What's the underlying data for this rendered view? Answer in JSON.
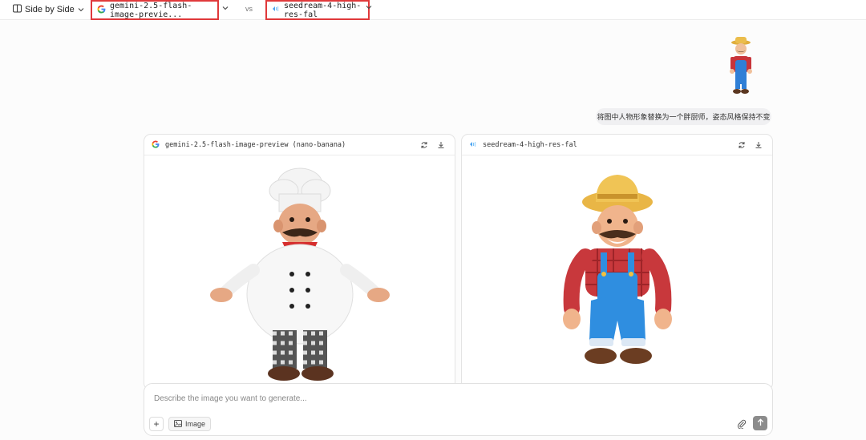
{
  "header": {
    "mode_label": "Side by Side",
    "model_a": "gemini-2.5-flash-image-previe...",
    "vs_label": "vs",
    "model_b": "seedream-4-high-res-fal"
  },
  "conversation": {
    "user_prompt": "将图中人物形象替换为一个胖厨师，姿态风格保持不变"
  },
  "panels": [
    {
      "title": "gemini-2.5-flash-image-preview (nano-banana)",
      "icon": "google-icon"
    },
    {
      "title": "seedream-4-high-res-fal",
      "icon": "seedream-icon"
    }
  ],
  "composer": {
    "placeholder": "Describe the image you want to generate...",
    "image_label": "Image"
  },
  "colors": {
    "highlight": "#e0393b",
    "send_button": "#8c8c8c"
  }
}
